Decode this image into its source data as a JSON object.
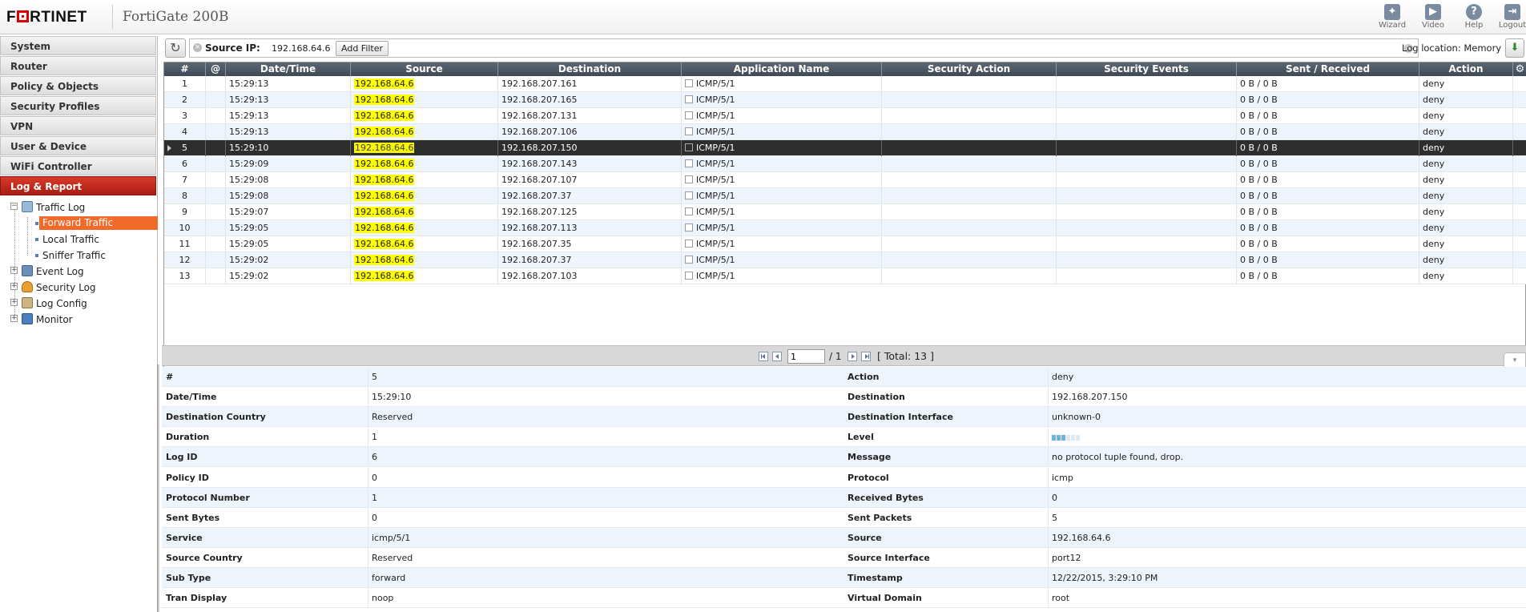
{
  "header": {
    "logo_text": "FRTINET",
    "device_name": "FortiGate 200B",
    "buttons": [
      {
        "label": "Wizard",
        "icon": "wizard-icon"
      },
      {
        "label": "Video",
        "icon": "video-icon"
      },
      {
        "label": "Help",
        "icon": "help-icon"
      },
      {
        "label": "Logout",
        "icon": "logout-icon"
      }
    ]
  },
  "sidebar": {
    "items": [
      {
        "label": "System"
      },
      {
        "label": "Router"
      },
      {
        "label": "Policy & Objects"
      },
      {
        "label": "Security Profiles"
      },
      {
        "label": "VPN"
      },
      {
        "label": "User & Device"
      },
      {
        "label": "WiFi Controller"
      },
      {
        "label": "Log & Report"
      }
    ],
    "tree": {
      "traffic_log": "Traffic Log",
      "forward_traffic": "Forward Traffic",
      "local_traffic": "Local Traffic",
      "sniffer_traffic": "Sniffer Traffic",
      "event_log": "Event Log",
      "security_log": "Security Log",
      "log_config": "Log Config",
      "monitor": "Monitor"
    }
  },
  "filterbar": {
    "filter_key": "Source IP:",
    "filter_value": "192.168.64.6",
    "add_filter_label": "Add Filter",
    "log_location": "Log location: Memory"
  },
  "grid": {
    "columns": [
      "#",
      "@",
      "Date/Time",
      "Source",
      "Destination",
      "Application Name",
      "Security Action",
      "Security Events",
      "Sent / Received",
      "Action"
    ],
    "rows": [
      {
        "n": "1",
        "time": "15:29:13",
        "src": "192.168.64.6",
        "dst": "192.168.207.161",
        "app": "ICMP/5/1",
        "bytes": "0 B / 0 B",
        "action": "deny"
      },
      {
        "n": "2",
        "time": "15:29:13",
        "src": "192.168.64.6",
        "dst": "192.168.207.165",
        "app": "ICMP/5/1",
        "bytes": "0 B / 0 B",
        "action": "deny"
      },
      {
        "n": "3",
        "time": "15:29:13",
        "src": "192.168.64.6",
        "dst": "192.168.207.131",
        "app": "ICMP/5/1",
        "bytes": "0 B / 0 B",
        "action": "deny"
      },
      {
        "n": "4",
        "time": "15:29:13",
        "src": "192.168.64.6",
        "dst": "192.168.207.106",
        "app": "ICMP/5/1",
        "bytes": "0 B / 0 B",
        "action": "deny"
      },
      {
        "n": "5",
        "time": "15:29:10",
        "src": "192.168.64.6",
        "dst": "192.168.207.150",
        "app": "ICMP/5/1",
        "bytes": "0 B / 0 B",
        "action": "deny"
      },
      {
        "n": "6",
        "time": "15:29:09",
        "src": "192.168.64.6",
        "dst": "192.168.207.143",
        "app": "ICMP/5/1",
        "bytes": "0 B / 0 B",
        "action": "deny"
      },
      {
        "n": "7",
        "time": "15:29:08",
        "src": "192.168.64.6",
        "dst": "192.168.207.107",
        "app": "ICMP/5/1",
        "bytes": "0 B / 0 B",
        "action": "deny"
      },
      {
        "n": "8",
        "time": "15:29:08",
        "src": "192.168.64.6",
        "dst": "192.168.207.37",
        "app": "ICMP/5/1",
        "bytes": "0 B / 0 B",
        "action": "deny"
      },
      {
        "n": "9",
        "time": "15:29:07",
        "src": "192.168.64.6",
        "dst": "192.168.207.125",
        "app": "ICMP/5/1",
        "bytes": "0 B / 0 B",
        "action": "deny"
      },
      {
        "n": "10",
        "time": "15:29:05",
        "src": "192.168.64.6",
        "dst": "192.168.207.113",
        "app": "ICMP/5/1",
        "bytes": "0 B / 0 B",
        "action": "deny"
      },
      {
        "n": "11",
        "time": "15:29:05",
        "src": "192.168.64.6",
        "dst": "192.168.207.35",
        "app": "ICMP/5/1",
        "bytes": "0 B / 0 B",
        "action": "deny"
      },
      {
        "n": "12",
        "time": "15:29:02",
        "src": "192.168.64.6",
        "dst": "192.168.207.37",
        "app": "ICMP/5/1",
        "bytes": "0 B / 0 B",
        "action": "deny"
      },
      {
        "n": "13",
        "time": "15:29:02",
        "src": "192.168.64.6",
        "dst": "192.168.207.103",
        "app": "ICMP/5/1",
        "bytes": "0 B / 0 B",
        "action": "deny"
      }
    ]
  },
  "pager": {
    "page": "1",
    "of": "/ 1",
    "total": "[ Total: 13 ]"
  },
  "details": [
    {
      "l1": "#",
      "v1": "5",
      "l2": "Action",
      "v2": "deny"
    },
    {
      "l1": "Date/Time",
      "v1": "15:29:10",
      "l2": "Destination",
      "v2": "192.168.207.150"
    },
    {
      "l1": "Destination Country",
      "v1": "Reserved",
      "l2": "Destination Interface",
      "v2": "unknown-0"
    },
    {
      "l1": "Duration",
      "v1": "1",
      "l2": "Level",
      "v2": ""
    },
    {
      "l1": "Log ID",
      "v1": "6",
      "l2": "Message",
      "v2": "no protocol tuple found, drop."
    },
    {
      "l1": "Policy ID",
      "v1": "0",
      "l2": "Protocol",
      "v2": "icmp"
    },
    {
      "l1": "Protocol Number",
      "v1": "1",
      "l2": "Received Bytes",
      "v2": "0"
    },
    {
      "l1": "Sent Bytes",
      "v1": "0",
      "l2": "Sent Packets",
      "v2": "5"
    },
    {
      "l1": "Service",
      "v1": "icmp/5/1",
      "l2": "Source",
      "v2": "192.168.64.6"
    },
    {
      "l1": "Source Country",
      "v1": "Reserved",
      "l2": "Source Interface",
      "v2": "port12"
    },
    {
      "l1": "Sub Type",
      "v1": "forward",
      "l2": "Timestamp",
      "v2": "12/22/2015, 3:29:10 PM"
    },
    {
      "l1": "Tran Display",
      "v1": "noop",
      "l2": "Virtual Domain",
      "v2": "root"
    }
  ],
  "level": {
    "filled": 3,
    "total": 6
  },
  "colors": {
    "accent": "#c0281b",
    "selection": "#f26a2a",
    "highlight": "#ffff00",
    "selected_row": "#2e2e2e"
  }
}
